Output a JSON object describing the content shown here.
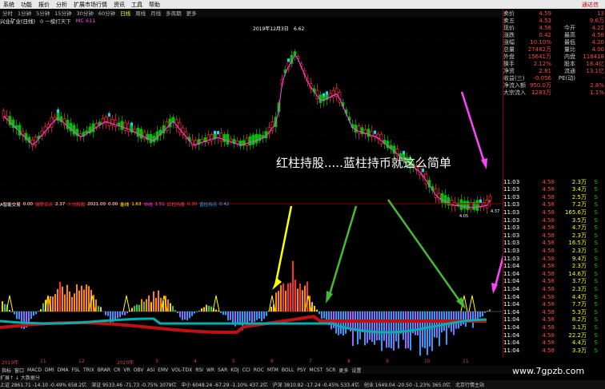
{
  "menubar": {
    "items": [
      "系统",
      "功能",
      "报价",
      "分析",
      "扩展市场行情",
      "资讯",
      "工具",
      "帮助"
    ],
    "brand": "通达信"
  },
  "toolbar": {
    "items": [
      "分时",
      "1分钟",
      "5分钟",
      "15分钟",
      "30分钟",
      "60分钟",
      "日线",
      "周线",
      "月线",
      "多周期",
      "更多"
    ],
    "active_index": 6
  },
  "stock_header": {
    "name": "兴业矿业(日线)",
    "note": "0 一模打天下",
    "ma": "MC 611"
  },
  "chart_annotation": {
    "date_label": "2019年12月3日",
    "high_label": "6.62",
    "low_label": "4.05",
    "right_label": "4.37"
  },
  "overlay_text": "红柱持股.....蓝柱持币就这么简单",
  "indicator_header": {
    "name": "A智能交易",
    "values": [
      "0.00",
      "强势买点",
      "2.37",
      "人均持股",
      "2021.00",
      "0.00",
      "能线",
      "1.63",
      "中线",
      "1.51",
      "红柱持股",
      "0.30",
      "蓝柱持币",
      "0.42"
    ]
  },
  "xaxis": {
    "labels": [
      "2019年",
      "11",
      "12",
      "2020年",
      "3",
      "4",
      "5",
      "6",
      "7",
      "8",
      "9",
      "10",
      "11"
    ]
  },
  "bottom_tabs": {
    "items": [
      "指标",
      "窗口",
      "MACD",
      "DMI",
      "DMA",
      "FSL",
      "TRIX",
      "BRAR",
      "CR",
      "VR",
      "OBV",
      "ASI",
      "EMV",
      "VOL-TDX",
      "RSI",
      "WR",
      "SAR",
      "KDJ",
      "CCI",
      "ROC",
      "MTM",
      "BOLL",
      "PSY",
      "MCST",
      "SCR",
      "更多",
      "设置"
    ]
  },
  "extra_tab": "扩展↑  ↓  大数据分",
  "right_panel": {
    "quote_rows": [
      {
        "l": "卖价",
        "v": "4.59",
        "r": "",
        "rv": "13"
      },
      {
        "l": "卖五",
        "v": "4.53",
        "r": "",
        "rv": "9.6万"
      },
      {
        "l": "现价",
        "v": "4.58",
        "r": "今开",
        "rv": "4.22"
      },
      {
        "l": "涨跌",
        "v": "0.42",
        "r": "最高",
        "rv": "4.58"
      },
      {
        "l": "涨幅",
        "v": "10.10%",
        "r": "最低",
        "rv": "4.20"
      },
      {
        "l": "总量",
        "v": "27482万",
        "r": "量比",
        "rv": "4.00"
      },
      {
        "l": "外盘",
        "v": "15641万",
        "r": "内盘",
        "rv": "118418"
      },
      {
        "l": "换手",
        "v": "2.12%",
        "r": "股本",
        "rv": "18.4亿"
      },
      {
        "l": "净资",
        "v": "2.81",
        "r": "流通",
        "rv": "13.1亿"
      },
      {
        "l": "收益(三)",
        "v": "-0.056",
        "r": "PE(动)",
        "rv": "-"
      },
      {
        "l": "净流入额",
        "v": "950.0万",
        "r": "",
        "rv": "2.8%"
      },
      {
        "l": "大宗流入",
        "v": "1283万",
        "r": "",
        "rv": "1.1%"
      }
    ],
    "ticks": [
      {
        "t": "11:03",
        "p": "4.58",
        "v": "2.3万",
        "d": "S"
      },
      {
        "t": "11:03",
        "p": "4.58",
        "v": "3.4万",
        "d": "S"
      },
      {
        "t": "11:03",
        "p": "4.58",
        "v": "2.5万",
        "d": "S"
      },
      {
        "t": "11:03",
        "p": "4.58",
        "v": "7.2万",
        "d": "S"
      },
      {
        "t": "11:03",
        "p": "4.58",
        "v": "165.6万",
        "d": "S"
      },
      {
        "t": "11:03",
        "p": "4.58",
        "v": "3.5万",
        "d": "S"
      },
      {
        "t": "11:03",
        "p": "4.58",
        "v": "4.7万",
        "d": "S"
      },
      {
        "t": "11:03",
        "p": "4.58",
        "v": "2.3万",
        "d": "S"
      },
      {
        "t": "11:03",
        "p": "4.58",
        "v": "16.5万",
        "d": "S"
      },
      {
        "t": "11:03",
        "p": "4.58",
        "v": "2.3万",
        "d": "S"
      },
      {
        "t": "11:03",
        "p": "4.58",
        "v": "9.4万",
        "d": "S"
      },
      {
        "t": "11:04",
        "p": "4.58",
        "v": "2.3万",
        "d": "S"
      },
      {
        "t": "11:04",
        "p": "4.58",
        "v": "14.6万",
        "d": "S"
      },
      {
        "t": "11:04",
        "p": "4.58",
        "v": "3.7万",
        "d": "S"
      },
      {
        "t": "11:04",
        "p": "4.58",
        "v": "2.3万",
        "d": "S"
      },
      {
        "t": "11:04",
        "p": "4.58",
        "v": "4.4万",
        "d": "S"
      },
      {
        "t": "11:04",
        "p": "4.58",
        "v": "7.7万",
        "d": "S"
      },
      {
        "t": "11:04",
        "p": "4.58",
        "v": "5.3万",
        "d": "S"
      },
      {
        "t": "11:04",
        "p": "4.58",
        "v": "8.2万",
        "d": "S"
      },
      {
        "t": "11:04",
        "p": "4.58",
        "v": "3.1万",
        "d": "S"
      },
      {
        "t": "11:04",
        "p": "4.58",
        "v": "22.2万",
        "d": "S"
      },
      {
        "t": "11:04",
        "p": "4.58",
        "v": "4.4万",
        "d": "S"
      },
      {
        "t": "11:04",
        "p": "4.58",
        "v": "3.3万",
        "d": "S"
      }
    ]
  },
  "statusbar": {
    "items": [
      "上证 2861.71 -14.10 -0.49% 658.2亿",
      "深证 9533.46 -71.73 -0.75% 1079亿",
      "中小 6048.24 -67.29 -1.10% 437.2亿",
      "沪深 3810.82 -17.24 -0.45% 533.4亿",
      "创业 1649.04 -20.50 -1.23% 365.0亿",
      "北京行情主站"
    ]
  },
  "watermark": "www.7gpzb.com",
  "colors": {
    "up": "#ff3030",
    "down": "#00c000",
    "blue": "#3399ff",
    "cyan": "#00e0ff",
    "magenta": "#ff44ff",
    "yellow": "#ffff00"
  }
}
